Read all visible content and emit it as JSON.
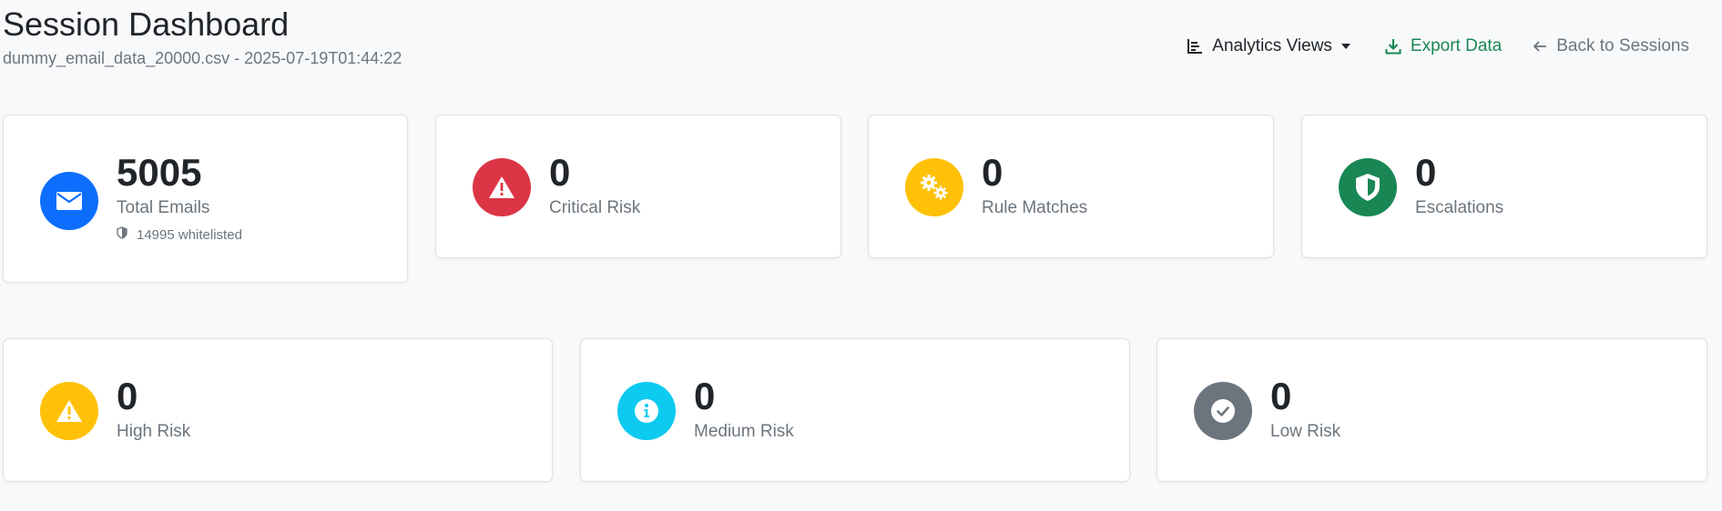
{
  "header": {
    "title": "Session Dashboard",
    "subtitle": "dummy_email_data_20000.csv - 2025-07-19T01:44:22"
  },
  "toolbar": {
    "analytics_label": "Analytics Views",
    "export_label": "Export Data",
    "back_label": "Back to Sessions"
  },
  "stats_top": [
    {
      "value": "5005",
      "label": "Total Emails",
      "sub": "14995 whitelisted",
      "icon": "envelope-icon",
      "color": "#0d6efd"
    },
    {
      "value": "0",
      "label": "Critical Risk",
      "icon": "warning-triangle-icon",
      "color": "#dc3545"
    },
    {
      "value": "0",
      "label": "Rule Matches",
      "icon": "gears-icon",
      "color": "#ffc107"
    },
    {
      "value": "0",
      "label": "Escalations",
      "icon": "shield-icon",
      "color": "#198754"
    }
  ],
  "stats_bottom": [
    {
      "value": "0",
      "label": "High Risk",
      "icon": "warning-triangle-icon",
      "color": "#ffc107"
    },
    {
      "value": "0",
      "label": "Medium Risk",
      "icon": "info-icon",
      "color": "#0dcaf0"
    },
    {
      "value": "0",
      "label": "Low Risk",
      "icon": "check-icon",
      "color": "#6c757d"
    }
  ]
}
